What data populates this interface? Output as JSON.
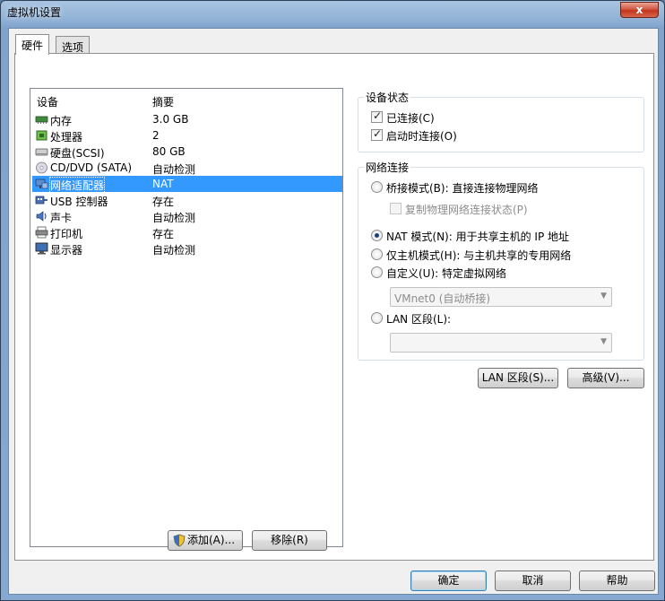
{
  "window": {
    "title": "虚拟机设置",
    "close_label": "x"
  },
  "tabs": [
    {
      "label": "硬件"
    },
    {
      "label": "选项"
    }
  ],
  "device_list": {
    "col_device": "设备",
    "col_summary": "摘要",
    "rows": [
      {
        "name": "内存",
        "summary": "3.0 GB",
        "icon": "memory-icon"
      },
      {
        "name": "处理器",
        "summary": "2",
        "icon": "processor-icon"
      },
      {
        "name": "硬盘(SCSI)",
        "summary": "80 GB",
        "icon": "hard-disk-icon"
      },
      {
        "name": "CD/DVD (SATA)",
        "summary": "自动检测",
        "icon": "cd-dvd-icon"
      },
      {
        "name": "网络适配器",
        "summary": "NAT",
        "icon": "network-adapter-icon",
        "selected": true
      },
      {
        "name": "USB 控制器",
        "summary": "存在",
        "icon": "usb-icon"
      },
      {
        "name": "声卡",
        "summary": "自动检测",
        "icon": "sound-card-icon"
      },
      {
        "name": "打印机",
        "summary": "存在",
        "icon": "printer-icon"
      },
      {
        "name": "显示器",
        "summary": "自动检测",
        "icon": "display-icon"
      }
    ]
  },
  "list_buttons": {
    "add": "添加(A)...",
    "remove": "移除(R)"
  },
  "device_status": {
    "title": "设备状态",
    "connected": {
      "label": "已连接(C)",
      "checked": true
    },
    "connect_at_power_on": {
      "label": "启动时连接(O)",
      "checked": true
    }
  },
  "network_connection": {
    "title": "网络连接",
    "bridged": {
      "label": "桥接模式(B): 直接连接物理网络",
      "selected": false
    },
    "replicate": {
      "label": "复制物理网络连接状态(P)",
      "checked": false,
      "disabled": true
    },
    "nat": {
      "label": "NAT 模式(N): 用于共享主机的 IP 地址",
      "selected": true
    },
    "host_only": {
      "label": "仅主机模式(H): 与主机共享的专用网络",
      "selected": false
    },
    "custom": {
      "label": "自定义(U): 特定虚拟网络",
      "selected": false
    },
    "custom_combo": "VMnet0 (自动桥接)",
    "lan_segment": {
      "label": "LAN 区段(L):",
      "selected": false
    },
    "lan_combo": ""
  },
  "panel_buttons": {
    "lan_segments": "LAN 区段(S)...",
    "advanced": "高级(V)..."
  },
  "dialog_buttons": {
    "ok": "确定",
    "cancel": "取消",
    "help": "帮助"
  },
  "colors": {
    "selection": "#3399ff",
    "title_gradient_top": "#a9c4e2",
    "close_red": "#c3341b"
  }
}
